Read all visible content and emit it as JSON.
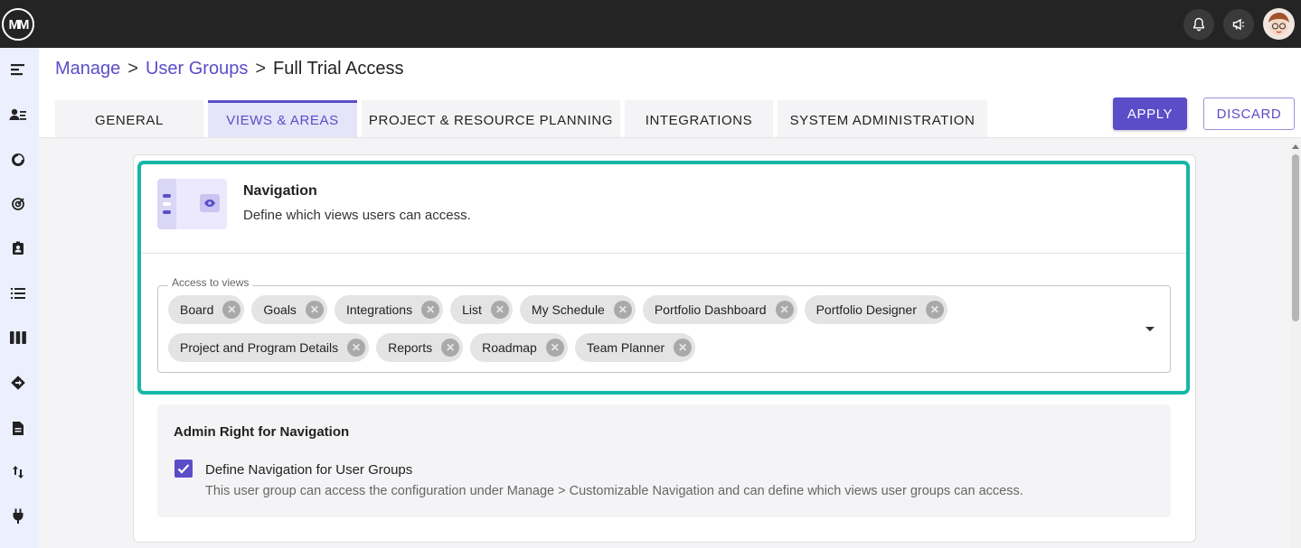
{
  "app": {
    "logo_text": "MM"
  },
  "topbar": {
    "icons": [
      "bell-icon",
      "megaphone-icon"
    ]
  },
  "sidebar": {
    "items": [
      "menu-icon",
      "users-icon",
      "dashboard-icon",
      "target-icon",
      "contact-icon",
      "list-icon",
      "board-icon",
      "roadmap-icon",
      "document-icon",
      "sort-icon",
      "plug-icon"
    ]
  },
  "breadcrumb": {
    "manage": "Manage",
    "user_groups": "User Groups",
    "current": "Full Trial Access",
    "separator": ">"
  },
  "tabs": [
    {
      "label": "GENERAL",
      "active": false
    },
    {
      "label": "VIEWS & AREAS",
      "active": true
    },
    {
      "label": "PROJECT & RESOURCE PLANNING",
      "active": false
    },
    {
      "label": "INTEGRATIONS",
      "active": false
    },
    {
      "label": "SYSTEM ADMINISTRATION",
      "active": false
    }
  ],
  "actions": {
    "apply": "APPLY",
    "discard": "DISCARD"
  },
  "navigation": {
    "title": "Navigation",
    "description": "Define which views users can access.",
    "field_label": "Access to views",
    "chips": [
      "Board",
      "Goals",
      "Integrations",
      "List",
      "My Schedule",
      "Portfolio Dashboard",
      "Portfolio Designer",
      "Project and Program Details",
      "Reports",
      "Roadmap",
      "Team Planner"
    ]
  },
  "admin": {
    "title": "Admin Right for Navigation",
    "checkbox_label": "Define Navigation for User Groups",
    "checkbox_checked": true,
    "description": "This user group can access the configuration under Manage > Customizable Navigation and can define which views user groups can access."
  },
  "colors": {
    "accent": "#5b4dc8",
    "highlight": "#16b7a6",
    "topbar": "#242424"
  }
}
